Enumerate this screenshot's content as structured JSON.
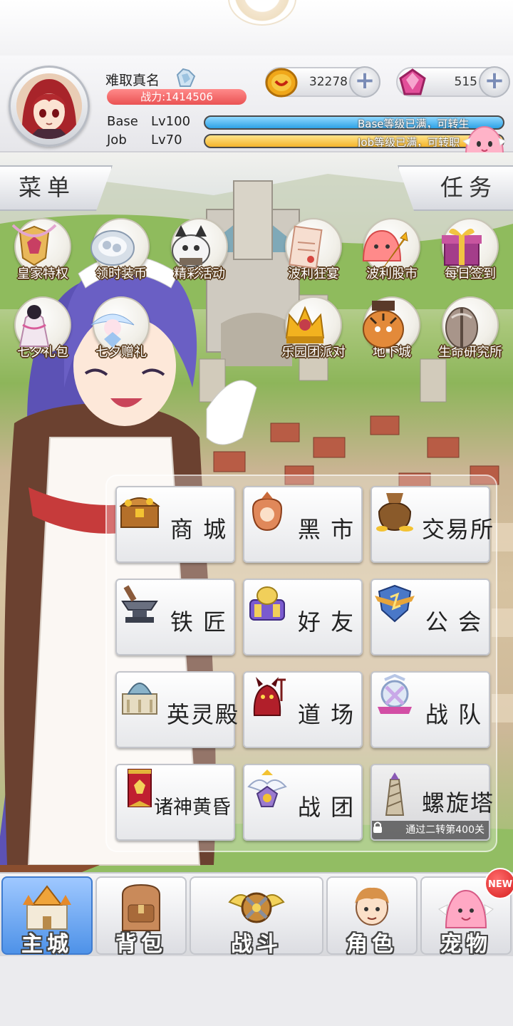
{
  "header": {
    "player_name": "难取真名",
    "combat_power": "战力:1414506",
    "gold": "32278",
    "gems": "515",
    "base_label": "Base",
    "base_level": "Lv100",
    "base_status": "Base等级已满，可转生",
    "job_label": "Job",
    "job_level": "Lv70",
    "job_status": "Job等级已满，可转职"
  },
  "side_tabs": {
    "menu": "菜单",
    "task": "任务"
  },
  "features": [
    {
      "label": "皇家特权",
      "icon": "royal-privilege-icon"
    },
    {
      "label": "领时装币",
      "icon": "fashion-coin-icon"
    },
    {
      "label": "精彩活动",
      "icon": "event-icon"
    },
    {
      "label": "波利狂宴",
      "icon": "poring-feast-icon"
    },
    {
      "label": "波利股市",
      "icon": "poring-stock-icon"
    },
    {
      "label": "每日签到",
      "icon": "daily-gift-icon"
    },
    {
      "label": "七夕礼包",
      "icon": "qixi-pack-icon"
    },
    {
      "label": "七夕赠礼",
      "icon": "qixi-gift-icon"
    },
    {
      "label": "乐园团派对",
      "icon": "party-crown-icon"
    },
    {
      "label": "地下城",
      "icon": "dungeon-tiger-icon"
    },
    {
      "label": "生命研究所",
      "icon": "life-lab-icon"
    }
  ],
  "grid": [
    {
      "label": "商 城",
      "icon": "treasure-chest-icon"
    },
    {
      "label": "黑 市",
      "icon": "black-market-bag-icon"
    },
    {
      "label": "交易所",
      "icon": "money-bag-icon"
    },
    {
      "label": "铁 匠",
      "icon": "anvil-icon"
    },
    {
      "label": "好 友",
      "icon": "friends-icon"
    },
    {
      "label": "公 会",
      "icon": "guild-shield-icon"
    },
    {
      "label": "英灵殿",
      "icon": "valhalla-icon"
    },
    {
      "label": "道 场",
      "icon": "dojo-devil-icon"
    },
    {
      "label": "战 队",
      "icon": "team-crest-icon"
    },
    {
      "label": "诸神黄昏",
      "icon": "ragnarok-banner-icon"
    },
    {
      "label": "战 团",
      "icon": "legion-crest-icon"
    },
    {
      "label": "螺旋塔",
      "icon": "spiral-tower-icon",
      "lock_note": "通过二转第400关"
    }
  ],
  "bottom_nav": [
    {
      "label": "主城",
      "icon": "castle-icon",
      "active": true
    },
    {
      "label": "背包",
      "icon": "backpack-icon"
    },
    {
      "label": "战斗",
      "icon": "battle-icon"
    },
    {
      "label": "角色",
      "icon": "character-icon"
    },
    {
      "label": "宠物",
      "icon": "pet-icon",
      "badge": "NEW"
    }
  ],
  "colors": {
    "power_bar": "#ea5253",
    "base_bar": "#2ea2e6",
    "job_bar": "#f5b52c",
    "active_tab": "#4e92e8",
    "label_outline": "#5a3c1d"
  },
  "progress": {
    "base": 1.0,
    "job": 1.0
  }
}
